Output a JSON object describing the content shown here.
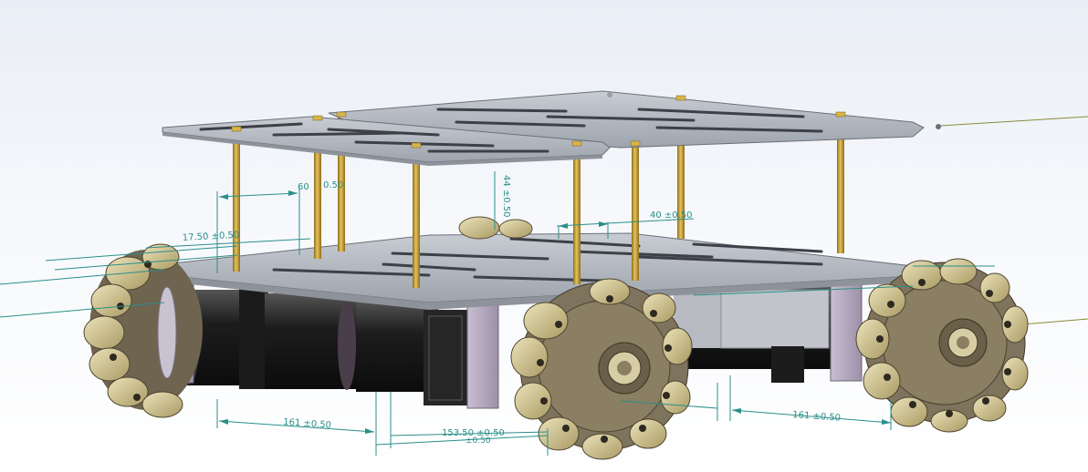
{
  "drawing": {
    "dimensions": {
      "top_left_angle": "17.50 ±0.50",
      "top_spacer_a": "60",
      "top_spacer_b": "0.50",
      "vertical_post": "44 ±0.50",
      "top_right": "40 ±0.50",
      "bottom_left": "161 ±0.50",
      "bottom_mid_a": "153.50 ±0.50",
      "bottom_mid_b": "±0.50",
      "bottom_right": "161 ±0.50"
    },
    "colors": {
      "background_top": "#e9edf5",
      "plate": "#b9bec6",
      "wheel": "#7e735c",
      "roller": "#d7cc9e",
      "motor": "#2a2a2a",
      "post": "#c9a23c",
      "bracket": "#b9adc3",
      "dimension": "#2a8f8a",
      "centerline": "#8b8b3b"
    }
  }
}
